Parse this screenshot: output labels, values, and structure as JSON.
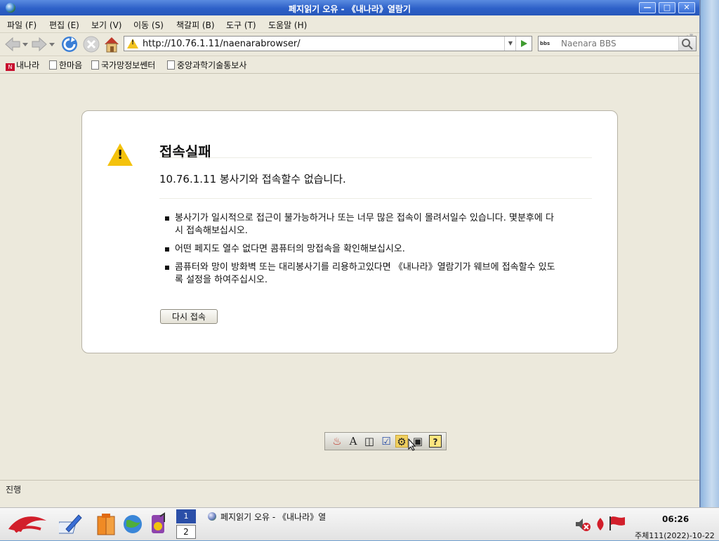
{
  "window": {
    "title": "페지읽기 오유 - 《내나라》열람기",
    "minimize_label": "—",
    "maximize_label": "□",
    "close_label": "✕"
  },
  "menu": [
    {
      "label": "파일 (F)"
    },
    {
      "label": "편집 (E)"
    },
    {
      "label": "보기 (V)"
    },
    {
      "label": "이동 (S)"
    },
    {
      "label": "책갈피 (B)"
    },
    {
      "label": "도구 (T)"
    },
    {
      "label": "도움말 (H)"
    }
  ],
  "nav": {
    "url": "http://10.76.1.11/naenarabrowser/",
    "search_placeholder": "Naenara BBS",
    "search_engine": "bbs"
  },
  "bookmarks": [
    {
      "label": "내나라",
      "icon": "naenara-logo"
    },
    {
      "label": "한마음",
      "icon": "doc-icon"
    },
    {
      "label": "국가망정보쎈터",
      "icon": "doc-icon"
    },
    {
      "label": "중앙과학기술통보사",
      "icon": "doc-icon"
    }
  ],
  "error": {
    "title": "접속실패",
    "description": "10.76.1.11 봉사기와 접속할수 없습니다.",
    "items": [
      "봉사기가 일시적으로 접근이 불가능하거나 또는 너무 많은 접속이 몰려서일수 있습니다. 몇분후에 다시 접속해보십시오.",
      "어떤 페지도 열수 없다면 콤퓨터의 망접속을 확인해보십시오.",
      "콤퓨터와 망이 방화벽 또는 대리봉사기를 리용하고있다면 《내나라》열람기가 웨브에 접속할수 있도록 설정을 하여주십시오."
    ],
    "retry_label": "다시 접속"
  },
  "mini_toolbar": {
    "font_label": "A",
    "help_label": "?"
  },
  "status": {
    "text": "진행"
  },
  "taskbar": {
    "pager_1": "1",
    "pager_2": "2",
    "task_label": "페지읽기 오유 - 《내나라》열",
    "clock": "06:26",
    "date": "주체111(2022)-10-22"
  },
  "colors": {
    "titlebar": "#2d60c8",
    "warning": "#f2c320",
    "go_arrow": "#3f9b2f"
  }
}
